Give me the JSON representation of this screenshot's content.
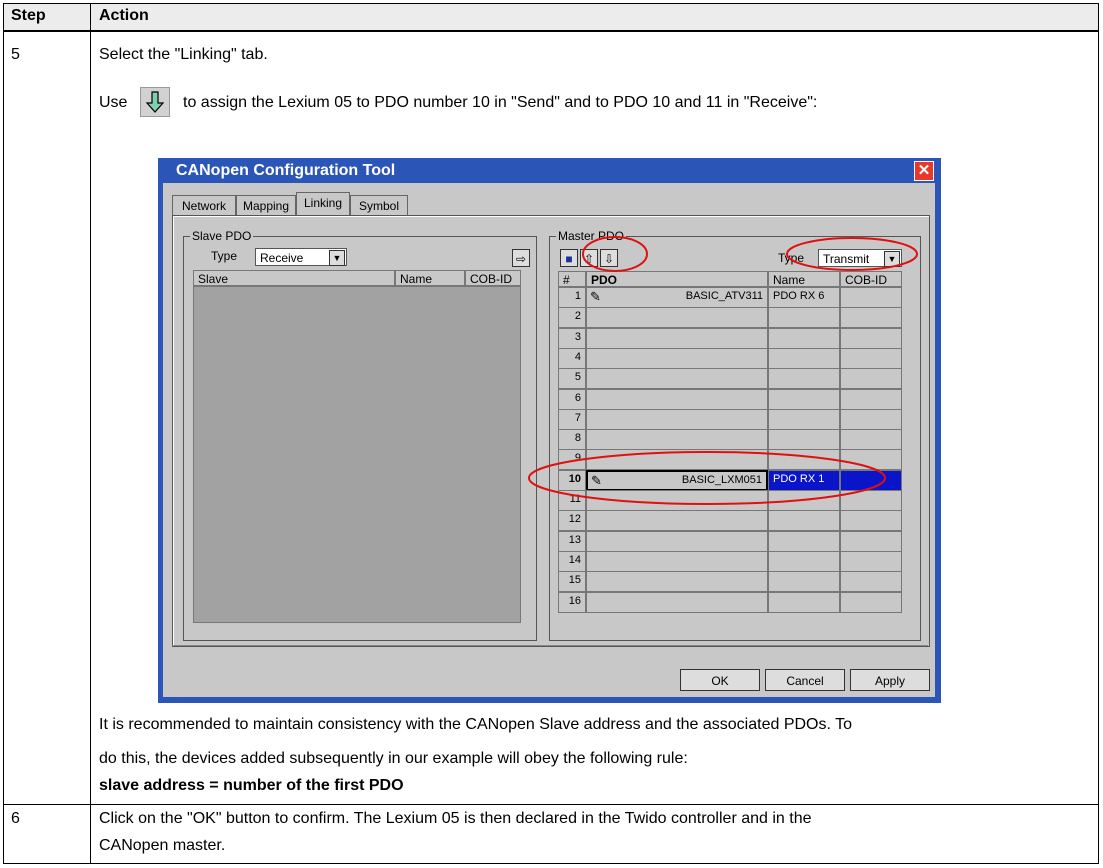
{
  "table": {
    "col_step": "Step",
    "col_action": "Action",
    "row5_step": "5",
    "row6_step": "6"
  },
  "step5": {
    "line1": "Select the \"Linking\" tab.",
    "use_prefix": "Use",
    "use_text": "to assign the Lexium 05 to PDO number 10 in \"Send\" and to PDO 10 and 11 in \"Receive\":",
    "note1": "It is recommended to maintain consistency with the CANopen Slave address and the associated PDOs. To",
    "note2": "do this, the devices added subsequently in our example will obey the following rule:",
    "rule": "slave address = number of the first PDO"
  },
  "step6": {
    "line1": "Click on the \"OK\" button to confirm. The Lexium 05 is then declared in the Twido controller and in the",
    "line2": "CANopen master."
  },
  "dialog": {
    "title": "CANopen Configuration Tool",
    "tabs": [
      "Network",
      "Mapping",
      "Linking",
      "Symbol"
    ],
    "active_tab": "Linking",
    "slave": {
      "label": "Slave PDO",
      "type_label": "Type",
      "type_value": "Receive",
      "col_slave": "Slave",
      "col_name": "Name",
      "col_cob": "COB-ID"
    },
    "master": {
      "label": "Master PDO",
      "type_label": "Type",
      "type_value": "Transmit",
      "col_num": "#",
      "col_pdo": "PDO",
      "col_name": "Name",
      "col_cob": "COB-ID",
      "rows": [
        {
          "num": "1",
          "pdo": "BASIC_ATV311",
          "name": "PDO RX 6"
        },
        {
          "num": "2",
          "pdo": "",
          "name": ""
        },
        {
          "num": "3",
          "pdo": "",
          "name": ""
        },
        {
          "num": "4",
          "pdo": "",
          "name": ""
        },
        {
          "num": "5",
          "pdo": "",
          "name": ""
        },
        {
          "num": "6",
          "pdo": "",
          "name": ""
        },
        {
          "num": "7",
          "pdo": "",
          "name": ""
        },
        {
          "num": "8",
          "pdo": "",
          "name": ""
        },
        {
          "num": "9",
          "pdo": "",
          "name": ""
        },
        {
          "num": "10",
          "pdo": "BASIC_LXM051",
          "name": "PDO RX 1"
        },
        {
          "num": "11",
          "pdo": "",
          "name": ""
        },
        {
          "num": "12",
          "pdo": "",
          "name": ""
        },
        {
          "num": "13",
          "pdo": "",
          "name": ""
        },
        {
          "num": "14",
          "pdo": "",
          "name": ""
        },
        {
          "num": "15",
          "pdo": "",
          "name": ""
        },
        {
          "num": "16",
          "pdo": "",
          "name": ""
        }
      ],
      "selected_row": "10"
    },
    "buttons": {
      "ok": "OK",
      "cancel": "Cancel",
      "apply": "Apply"
    }
  },
  "colors": {
    "title_bar": "#2c55b8",
    "selection": "#0a14c8",
    "annotation": "#e01010"
  }
}
